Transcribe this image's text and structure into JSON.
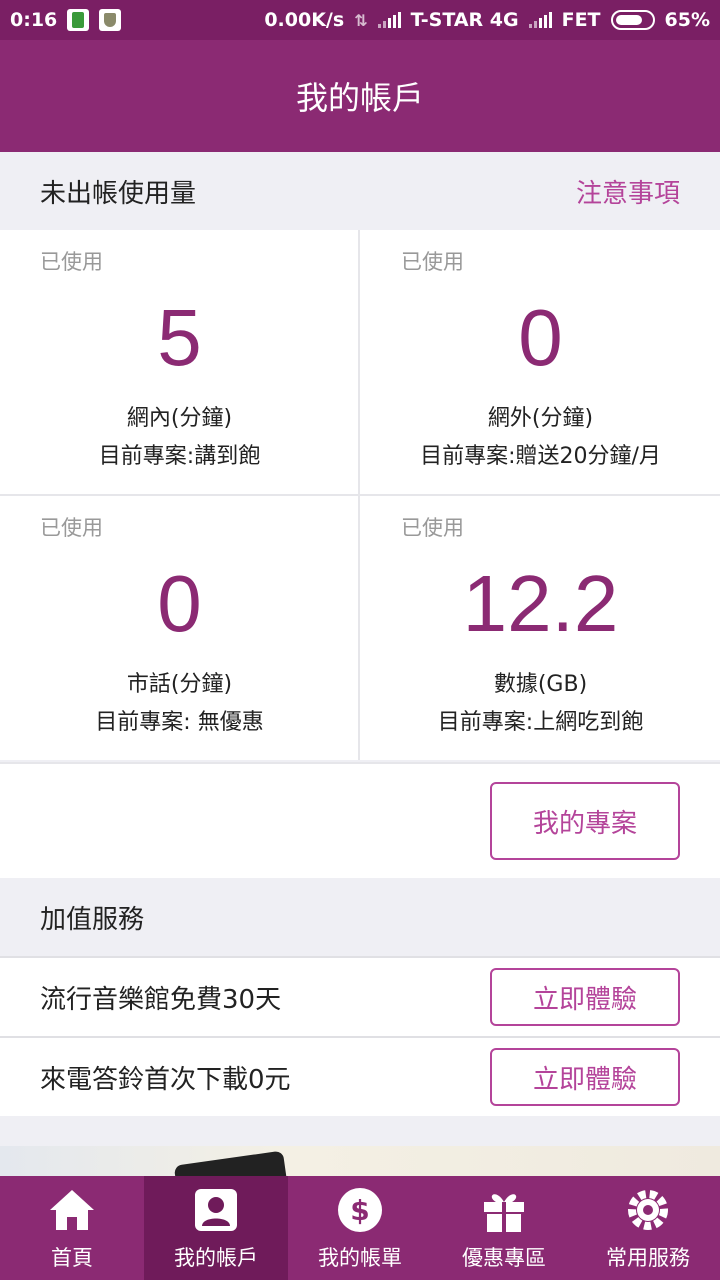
{
  "status_bar": {
    "time": "0:16",
    "net_speed": "0.00K/s",
    "carrier1": "T-STAR 4G",
    "carrier2": "FET",
    "battery": "65%"
  },
  "header": {
    "title": "我的帳戶"
  },
  "usage": {
    "section_title": "未出帳使用量",
    "notice_link": "注意事項",
    "cards": [
      {
        "used_label": "已使用",
        "value": "5",
        "label": "網內(分鐘)",
        "plan": "目前專案:講到飽"
      },
      {
        "used_label": "已使用",
        "value": "0",
        "label": "網外(分鐘)",
        "plan": "目前專案:贈送20分鐘/月"
      },
      {
        "used_label": "已使用",
        "value": "0",
        "label": "市話(分鐘)",
        "plan": "目前專案: 無優惠"
      },
      {
        "used_label": "已使用",
        "value": "12.2",
        "label": "數據(GB)",
        "plan": "目前專案:上網吃到飽"
      }
    ],
    "my_plan_button": "我的專案"
  },
  "value_added": {
    "section_title": "加值服務",
    "items": [
      {
        "name": "流行音樂館免費30天",
        "button": "立即體驗"
      },
      {
        "name": "來電答鈴首次下載0元",
        "button": "立即體驗"
      }
    ]
  },
  "tabs": [
    {
      "label": "首頁",
      "icon": "home-icon"
    },
    {
      "label": "我的帳戶",
      "icon": "account-icon",
      "active": true
    },
    {
      "label": "我的帳單",
      "icon": "dollar-icon"
    },
    {
      "label": "優惠專區",
      "icon": "gift-icon"
    },
    {
      "label": "常用服務",
      "icon": "gear-icon"
    }
  ],
  "colors": {
    "brand": "#8b2a73",
    "brand_dark": "#7a1f64",
    "accent": "#b4449a"
  }
}
